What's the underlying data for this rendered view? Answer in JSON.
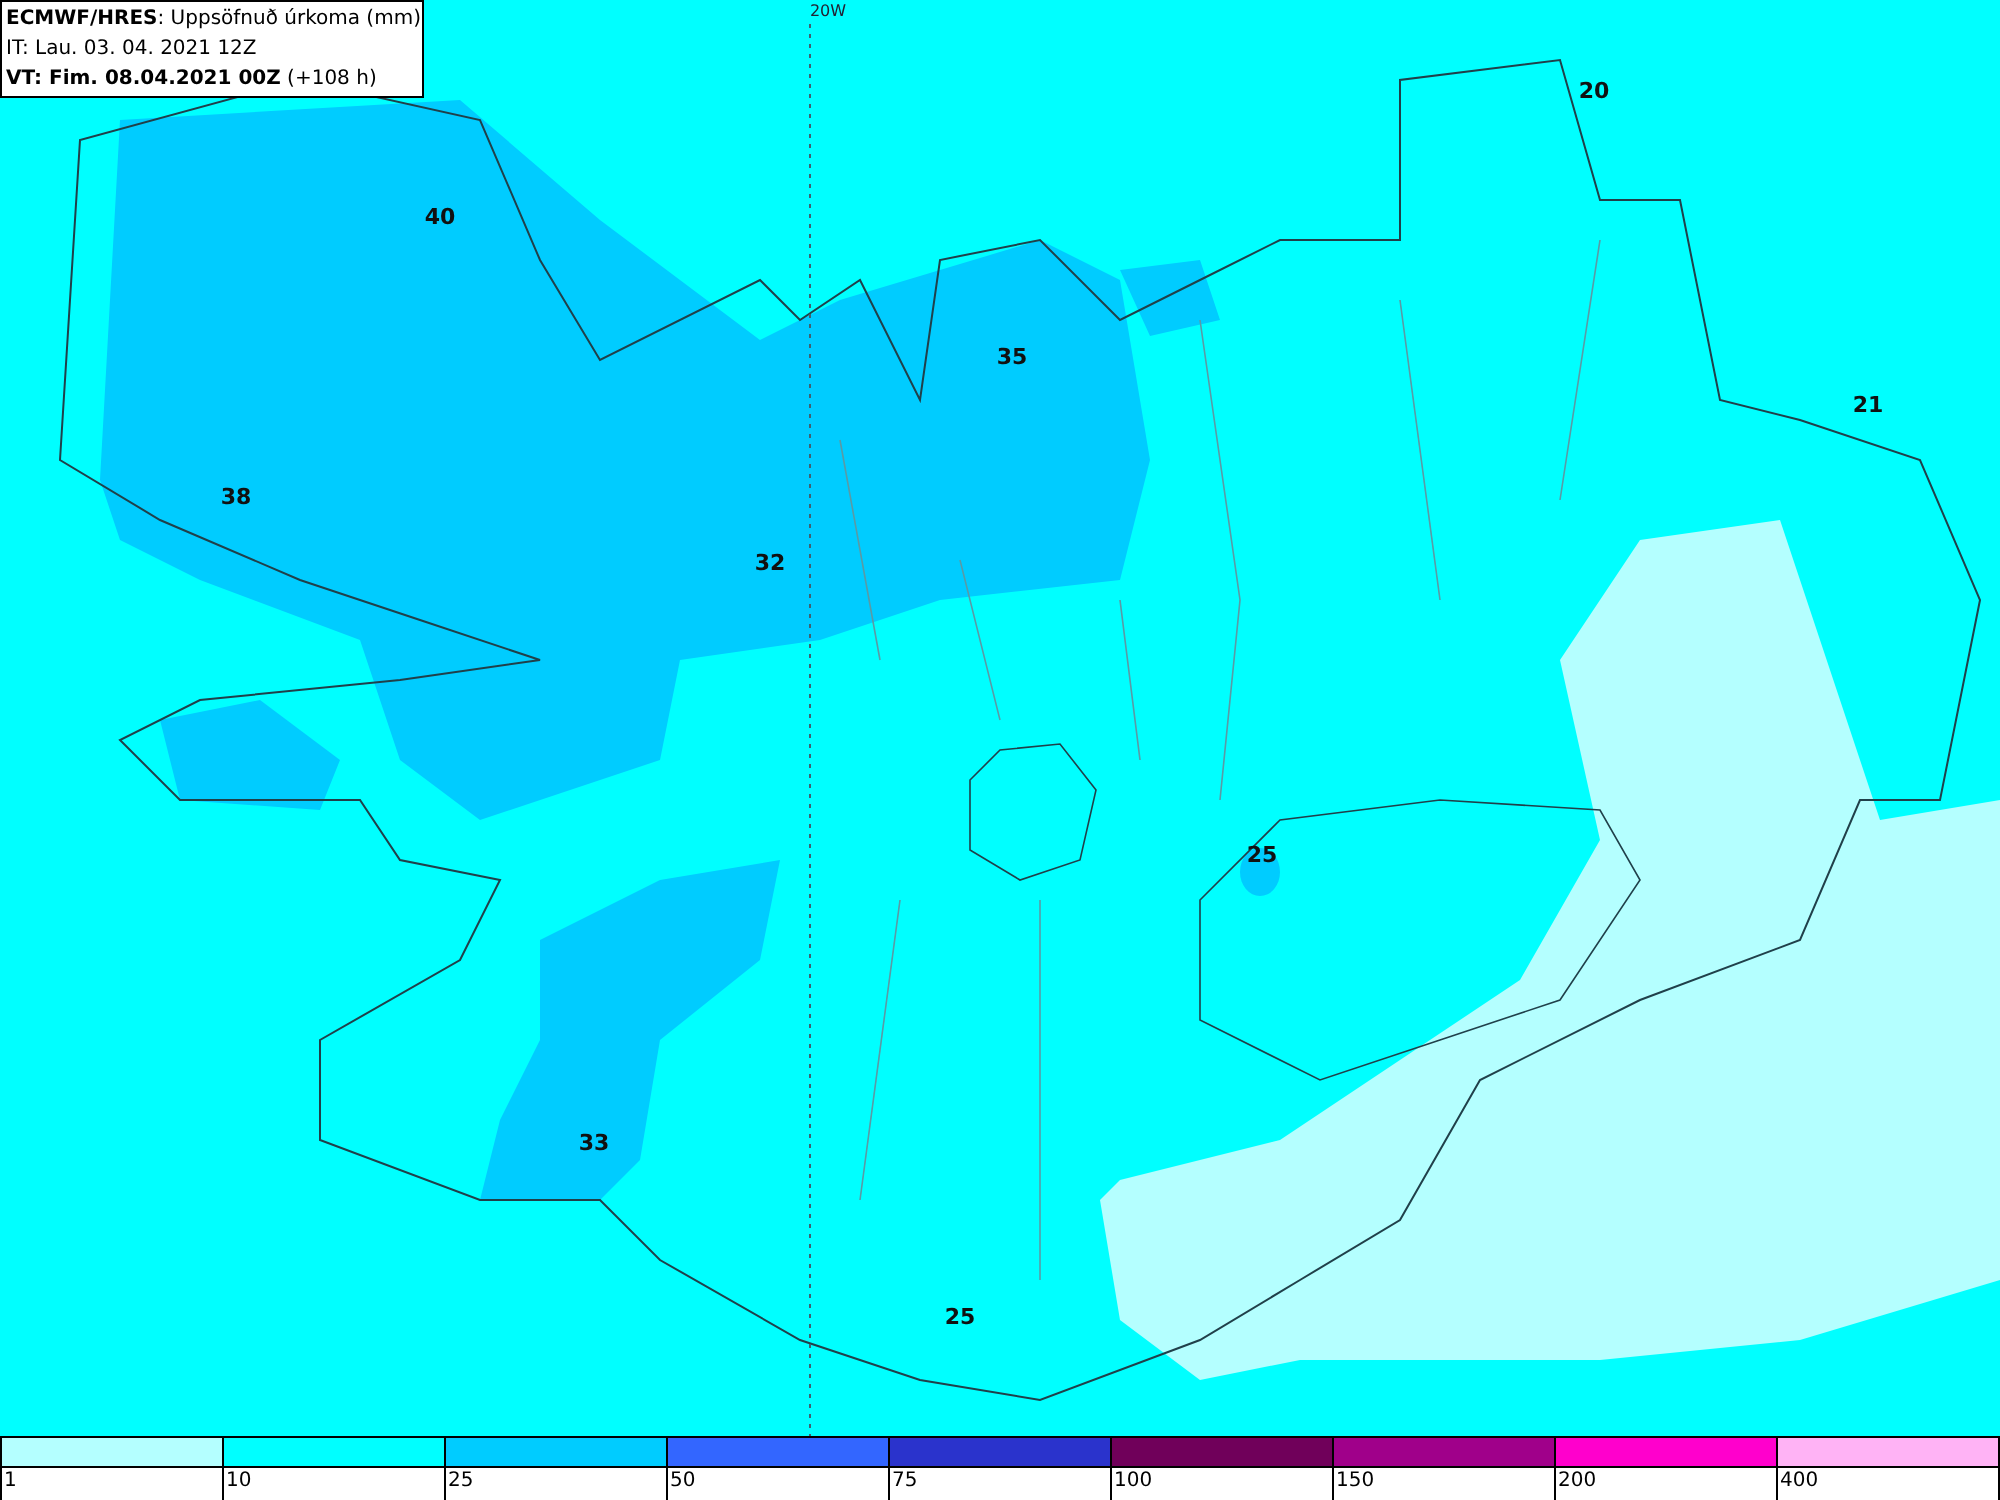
{
  "header": {
    "lines": [
      "**ECMWF/HRES**: Uppsöfnuð úrkoma (mm)",
      "IT: Lau. 03. 04. 2021 12Z",
      "**VT: Fim. 08.04.2021 00Z** (+108 h)"
    ]
  },
  "meridian_label": "20W",
  "contour_labels": [
    "20",
    "40",
    "35",
    "21",
    "38",
    "32",
    "25",
    "33",
    "25"
  ],
  "legend": [
    {
      "label": "1",
      "color": "#b4ffff"
    },
    {
      "label": "10",
      "color": "#00ffff"
    },
    {
      "label": "25",
      "color": "#00ccff"
    },
    {
      "label": "50",
      "color": "#3366ff"
    },
    {
      "label": "75",
      "color": "#2a33cc"
    },
    {
      "label": "100",
      "color": "#70005a"
    },
    {
      "label": "150",
      "color": "#a0008a"
    },
    {
      "label": "200",
      "color": "#ff00cc"
    },
    {
      "label": "400",
      "color": "#ffb3f5"
    }
  ]
}
